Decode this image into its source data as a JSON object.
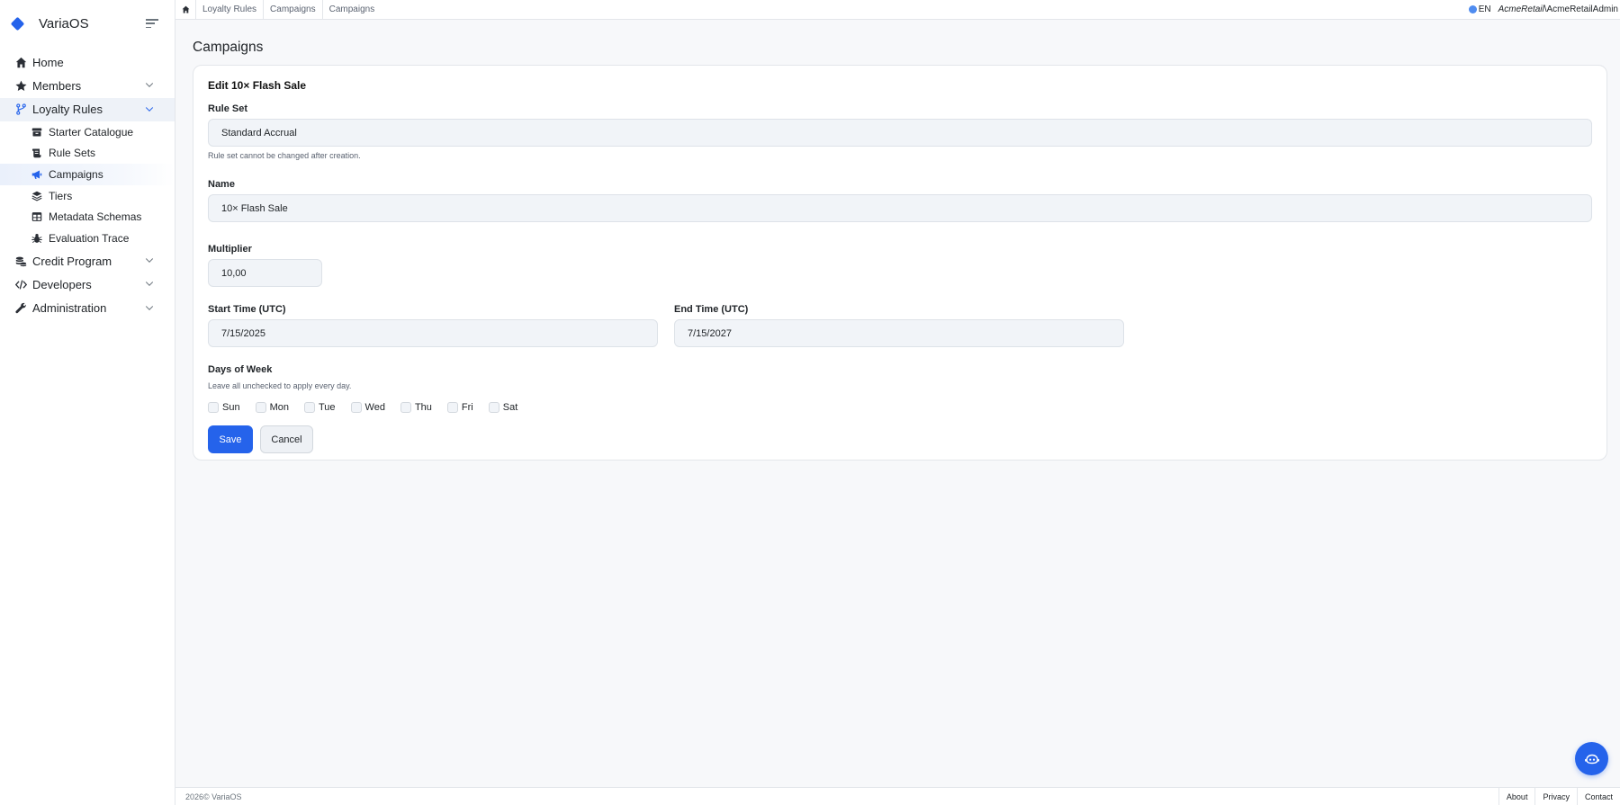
{
  "app": {
    "name": "VariaOS"
  },
  "sidebar": {
    "items": [
      {
        "label": "Home",
        "icon": "home-icon"
      },
      {
        "label": "Members",
        "icon": "star-icon",
        "expandable": true
      },
      {
        "label": "Loyalty Rules",
        "icon": "branch-icon",
        "expandable": true,
        "expanded": true,
        "children": [
          {
            "label": "Starter Catalogue",
            "icon": "archive-icon"
          },
          {
            "label": "Rule Sets",
            "icon": "scroll-icon"
          },
          {
            "label": "Campaigns",
            "icon": "megaphone-icon",
            "active": true
          },
          {
            "label": "Tiers",
            "icon": "layers-icon"
          },
          {
            "label": "Metadata Schemas",
            "icon": "table-icon"
          },
          {
            "label": "Evaluation Trace",
            "icon": "bug-icon"
          }
        ]
      },
      {
        "label": "Credit Program",
        "icon": "coins-icon",
        "expandable": true
      },
      {
        "label": "Developers",
        "icon": "code-icon",
        "expandable": true
      },
      {
        "label": "Administration",
        "icon": "wrench-icon",
        "expandable": true
      }
    ]
  },
  "topbar": {
    "breadcrumbs": [
      "Loyalty Rules",
      "Campaigns",
      "Campaigns"
    ],
    "language": "EN",
    "tenant": "AcmeRetail",
    "separator": "\\",
    "user": "AcmeRetailAdmin"
  },
  "page": {
    "title": "Campaigns"
  },
  "form": {
    "title": "Edit 10× Flash Sale",
    "rule_set": {
      "label": "Rule Set",
      "value": "Standard Accrual",
      "hint": "Rule set cannot be changed after creation."
    },
    "name": {
      "label": "Name",
      "value": "10× Flash Sale"
    },
    "multiplier": {
      "label": "Multiplier",
      "value": "10,00"
    },
    "start_time": {
      "label": "Start Time (UTC)",
      "value": "7/15/2025"
    },
    "end_time": {
      "label": "End Time (UTC)",
      "value": "7/15/2027"
    },
    "days_of_week": {
      "label": "Days of Week",
      "hint": "Leave all unchecked to apply every day.",
      "days": [
        "Sun",
        "Mon",
        "Tue",
        "Wed",
        "Thu",
        "Fri",
        "Sat"
      ]
    },
    "save_label": "Save",
    "cancel_label": "Cancel"
  },
  "footer": {
    "copyright": "2026© VariaOS",
    "links": [
      "About",
      "Privacy",
      "Contact"
    ]
  },
  "colors": {
    "accent": "#2563eb",
    "background": "#f7f8fa",
    "input_bg": "#f1f4f8"
  }
}
